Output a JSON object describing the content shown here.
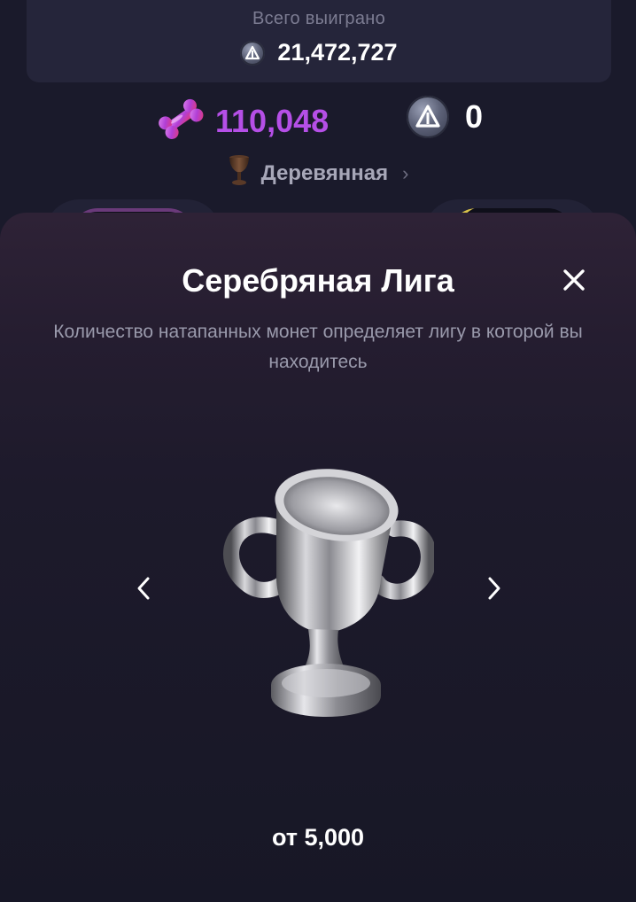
{
  "header": {
    "total_won_label": "Всего выиграно",
    "total_won_value": "21,472,727"
  },
  "balances": {
    "bones_value": "110,048",
    "coins_value": "0"
  },
  "current_league": {
    "name": "Деревянная",
    "icon": "wooden-cup-icon"
  },
  "league_sheet": {
    "title": "Серебряная Лига",
    "description": "Количество натапанных монет определяет лигу в которой вы находитесь",
    "threshold": "от 5,000",
    "icon": "silver-trophy-icon"
  },
  "colors": {
    "background": "#1a1a2b",
    "card": "#25253a",
    "bones_accent": "#b54fe7",
    "muted_text": "#9a9aac"
  }
}
